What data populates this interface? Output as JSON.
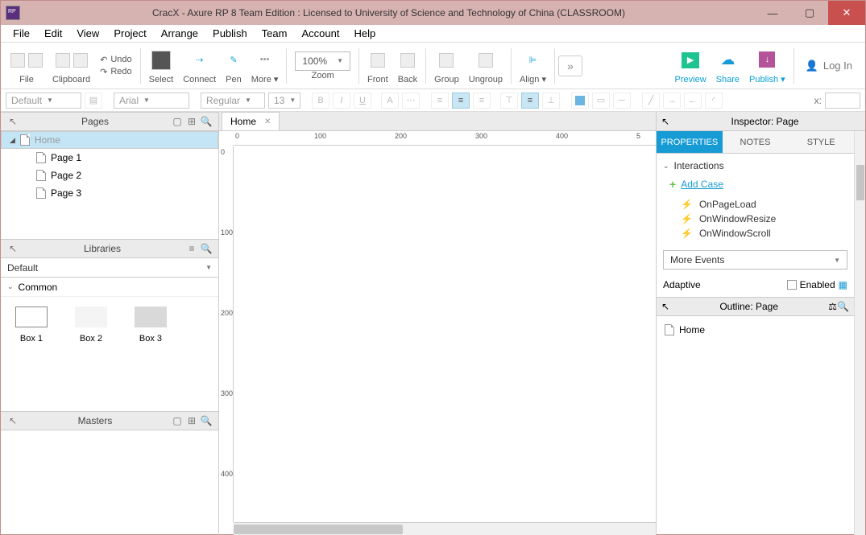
{
  "window": {
    "title": "CracX - Axure RP 8 Team Edition : Licensed to University of Science and Technology of China (CLASSROOM)"
  },
  "menu": {
    "items": [
      "File",
      "Edit",
      "View",
      "Project",
      "Arrange",
      "Publish",
      "Team",
      "Account",
      "Help"
    ]
  },
  "toolbar": {
    "file": "File",
    "clipboard": "Clipboard",
    "undo": "Undo",
    "redo": "Redo",
    "select": "Select",
    "connect": "Connect",
    "pen": "Pen",
    "more": "More ▾",
    "zoom_value": "100%",
    "zoom": "Zoom",
    "front": "Front",
    "back": "Back",
    "group": "Group",
    "ungroup": "Ungroup",
    "align": "Align ▾",
    "preview": "Preview",
    "share": "Share",
    "publish": "Publish ▾",
    "login": "Log In"
  },
  "format": {
    "style": "Default",
    "font": "Arial",
    "weight": "Regular",
    "size": "13",
    "xlabel": "x:"
  },
  "pages": {
    "title": "Pages",
    "items": [
      {
        "name": "Home",
        "selected": true,
        "level": 0
      },
      {
        "name": "Page 1",
        "level": 1
      },
      {
        "name": "Page 2",
        "level": 1
      },
      {
        "name": "Page 3",
        "level": 1
      }
    ]
  },
  "libraries": {
    "title": "Libraries",
    "selected": "Default",
    "category": "Common",
    "shapes": [
      "Box 1",
      "Box 2",
      "Box 3"
    ]
  },
  "masters": {
    "title": "Masters"
  },
  "canvas": {
    "tab": "Home",
    "ruler_h": [
      "0",
      "100",
      "200",
      "300",
      "400",
      "5"
    ],
    "ruler_v": [
      "0",
      "100",
      "200",
      "300",
      "400"
    ]
  },
  "inspector": {
    "title": "Inspector: Page",
    "tabs": [
      "PROPERTIES",
      "NOTES",
      "STYLE"
    ],
    "section": "Interactions",
    "add_case": "Add Case",
    "events": [
      "OnPageLoad",
      "OnWindowResize",
      "OnWindowScroll"
    ],
    "more_events": "More Events",
    "adaptive": "Adaptive",
    "enabled": "Enabled"
  },
  "outline": {
    "title": "Outline: Page",
    "item": "Home"
  }
}
